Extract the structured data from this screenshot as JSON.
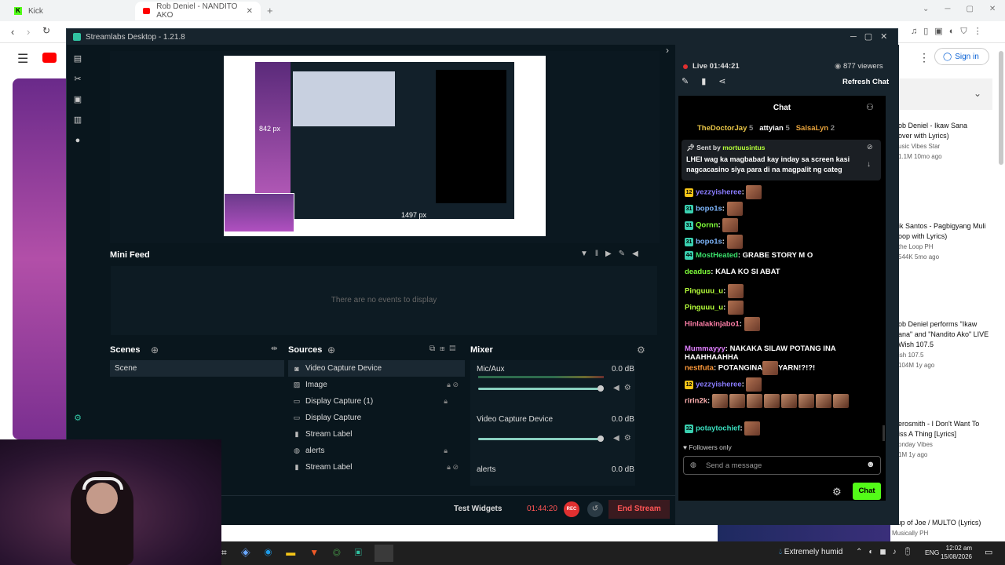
{
  "browser": {
    "tabs": [
      {
        "label": "Kick"
      },
      {
        "label": "Rob Deniel - NANDITO AKO"
      }
    ],
    "new_tab": "+"
  },
  "youtube": {
    "logo": "YouTube",
    "sign_in": "Sign in",
    "sidebar_videos": [
      {
        "title": "ob Deniel - Ikaw Sana",
        "title2": "over with Lyrics)",
        "channel": "usic Vibes Star",
        "meta": "1.1M  10mo ago"
      },
      {
        "title": "ik Santos - Pagbigyang Muli",
        "title2": "oop with Lyrics)",
        "channel": "the Loop PH",
        "meta": "544K  5mo ago"
      },
      {
        "title": "ob Deniel performs \"Ikaw",
        "title2": "ana\" and \"Nandito Ako\" LIVE",
        "title3": "Wish 107.5",
        "channel": "ish 107.5",
        "meta": "104M  1y ago"
      },
      {
        "title": "erosmith - I Don't Want To",
        "title2": "iss A Thing [Lyrics]",
        "channel": "onday Vibes",
        "meta": "1M  1y ago"
      },
      {
        "title": "Cup of Joe / MULTO (Lyrics)",
        "channel": "Musically PH"
      }
    ]
  },
  "streamlabs": {
    "title": "Streamlabs Desktop - 1.21.8",
    "preview": {
      "px_label_1": "842 px",
      "px_label_2": "1497 px"
    },
    "mini_feed": {
      "title": "Mini Feed",
      "empty": "There are no events to display"
    },
    "scenes": {
      "title": "Scenes",
      "items": [
        "Scene"
      ]
    },
    "sources": {
      "title": "Sources",
      "items": [
        {
          "label": "Video Capture Device",
          "icon": "camera-icon"
        },
        {
          "label": "Image",
          "icon": "image-icon"
        },
        {
          "label": "Display Capture (1)",
          "icon": "monitor-icon"
        },
        {
          "label": "Display Capture",
          "icon": "monitor-icon"
        },
        {
          "label": "Stream Label",
          "icon": "file-icon"
        },
        {
          "label": "alerts",
          "icon": "globe-icon"
        },
        {
          "label": "Stream Label",
          "icon": "file-icon"
        }
      ]
    },
    "mixer": {
      "title": "Mixer",
      "channels": [
        {
          "name": "Mic/Aux",
          "db": "0.0 dB",
          "level": 0.97
        },
        {
          "name": "Video Capture Device",
          "db": "0.0 dB",
          "level": 0.97
        },
        {
          "name": "alerts",
          "db": "0.0 dB"
        }
      ]
    },
    "footer": {
      "test_widgets": "Test Widgets",
      "timer": "01:44:20",
      "rec": "REC",
      "end_stream": "End Stream"
    }
  },
  "chat_dock": {
    "live": "Live 01:44:21",
    "viewers": "877 viewers",
    "refresh": "Refresh Chat",
    "chat_title": "Chat",
    "top_gifters": [
      {
        "name": "TheDoctorJay",
        "count": "5",
        "color": "#e8c547"
      },
      {
        "name": "attyian",
        "count": "5",
        "color": "#ffffff"
      },
      {
        "name": "SalsaLyn",
        "count": "2",
        "color": "#e6a23c"
      }
    ],
    "pinned": {
      "sent_by": "Sent by",
      "author": "mortuusintus",
      "text_line1": "LHEI wag ka magbabad kay inday sa screen kasi",
      "text_line2": "nagcacasino siya para di na magpalit ng categ"
    },
    "messages": [
      {
        "user": "yezzyisheree",
        "text": "",
        "color": "#8a7cff",
        "badge": "12",
        "badge_color": "#f5c518",
        "emote": true
      },
      {
        "user": "bopo1s",
        "text": "",
        "color": "#7fb8ff",
        "badge": "31",
        "badge_color": "#3ad0b0",
        "emote": true
      },
      {
        "user": "Qornn",
        "text": "",
        "color": "#7fff3a",
        "badge": "31",
        "badge_color": "#3ad0b0",
        "emote": true
      },
      {
        "user": "bopo1s",
        "text": "",
        "color": "#7fb8ff",
        "badge": "31",
        "badge_color": "#3ad0b0",
        "emote": true
      },
      {
        "user": "MostHeated",
        "text": "GRABE STORY M O",
        "color": "#3ae06b",
        "badge": "44",
        "badge_color": "#3ad0b0"
      },
      {
        "user": "deadus",
        "text": "KALA KO SI ABAT",
        "color": "#7fff3a"
      },
      {
        "user": "Pinguuu_u",
        "text": "",
        "color": "#b6ff3a",
        "emote": true
      },
      {
        "user": "Pinguuu_u",
        "text": "",
        "color": "#b6ff3a",
        "emote": true
      },
      {
        "user": "Hinlalakinjabo1",
        "text": "",
        "color": "#ff7fa8",
        "emote": true
      },
      {
        "user": "Mummayyy",
        "text": "NAKAKA SILAW POTANG INA",
        "text2": "HAAHHAAHHA",
        "color": "#e07fff"
      },
      {
        "user": "nestfuta",
        "text": "POTANGINA",
        "text_after": "YARN!?!?!",
        "color": "#ff9a3a",
        "emote": true
      },
      {
        "user": "yezzyisheree",
        "text": "",
        "color": "#8a7cff",
        "badge": "12",
        "badge_color": "#f5c518",
        "emote": true
      },
      {
        "user": "ririn2k",
        "text": "",
        "color": "#ffb0b0",
        "emote_row": true
      },
      {
        "user": "potaytochief",
        "text": "",
        "color": "#3ae0c0",
        "badge": "32",
        "badge_color": "#3ad0b0",
        "emote": true
      }
    ],
    "followers_only": "Followers only",
    "input_placeholder": "Send a message",
    "chat_button": "Chat"
  },
  "taskbar": {
    "weather": "Extremely humid",
    "lang": "ENG",
    "time": "12:02 am",
    "date": "15/08/2026"
  }
}
